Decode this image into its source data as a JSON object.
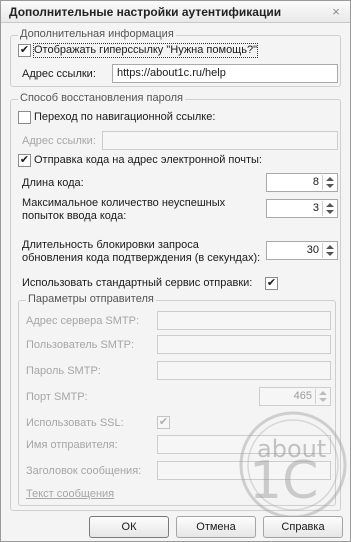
{
  "window": {
    "title": "Дополнительные настройки аутентификации",
    "close_glyph": "×"
  },
  "additional_info": {
    "legend": "Дополнительная информация",
    "show_help_link": {
      "label": "Отображать гиперссылку \"Нужна помощь?\"",
      "checked": true
    },
    "link_address": {
      "label": "Адрес ссылки:",
      "value": "https://about1c.ru/help"
    }
  },
  "recovery": {
    "legend": "Способ восстановления пароля",
    "nav_link": {
      "label": "Переход по навигационной ссылке:",
      "checked": false
    },
    "nav_link_address": {
      "label": "Адрес ссылки:",
      "value": ""
    },
    "send_code": {
      "label": "Отправка кода на адрес электронной почты:",
      "checked": true
    },
    "code_length": {
      "label": "Длина кода:",
      "value": "8"
    },
    "max_attempts": {
      "label_line1": "Максимальное количество неуспешных",
      "label_line2": "попыток ввода кода:",
      "value": "3"
    },
    "block_duration": {
      "label_line1": "Длительность блокировки запроса",
      "label_line2": "обновления кода подтверждения (в секундах):",
      "value": "30"
    },
    "use_standard_service": {
      "label": "Использовать стандартный сервис отправки:",
      "checked": true
    },
    "sender": {
      "legend": "Параметры отправителя",
      "smtp_server": {
        "label": "Адрес сервера SMTP:",
        "value": ""
      },
      "smtp_user": {
        "label": "Пользователь SMTP:",
        "value": ""
      },
      "smtp_password": {
        "label": "Пароль SMTP:",
        "value": ""
      },
      "smtp_port": {
        "label": "Порт SMTP:",
        "value": "465"
      },
      "use_ssl": {
        "label": "Использовать SSL:",
        "checked": true
      },
      "sender_name": {
        "label": "Имя отправителя:",
        "value": ""
      },
      "message_subject": {
        "label": "Заголовок сообщения:",
        "value": ""
      },
      "message_text_link": "Текст сообщения"
    }
  },
  "footer": {
    "ok": "ОК",
    "cancel": "Отмена",
    "help": "Справка"
  },
  "watermark": {
    "line1": "about",
    "line2": "1C"
  },
  "icons": {
    "checkmark": "✔"
  }
}
